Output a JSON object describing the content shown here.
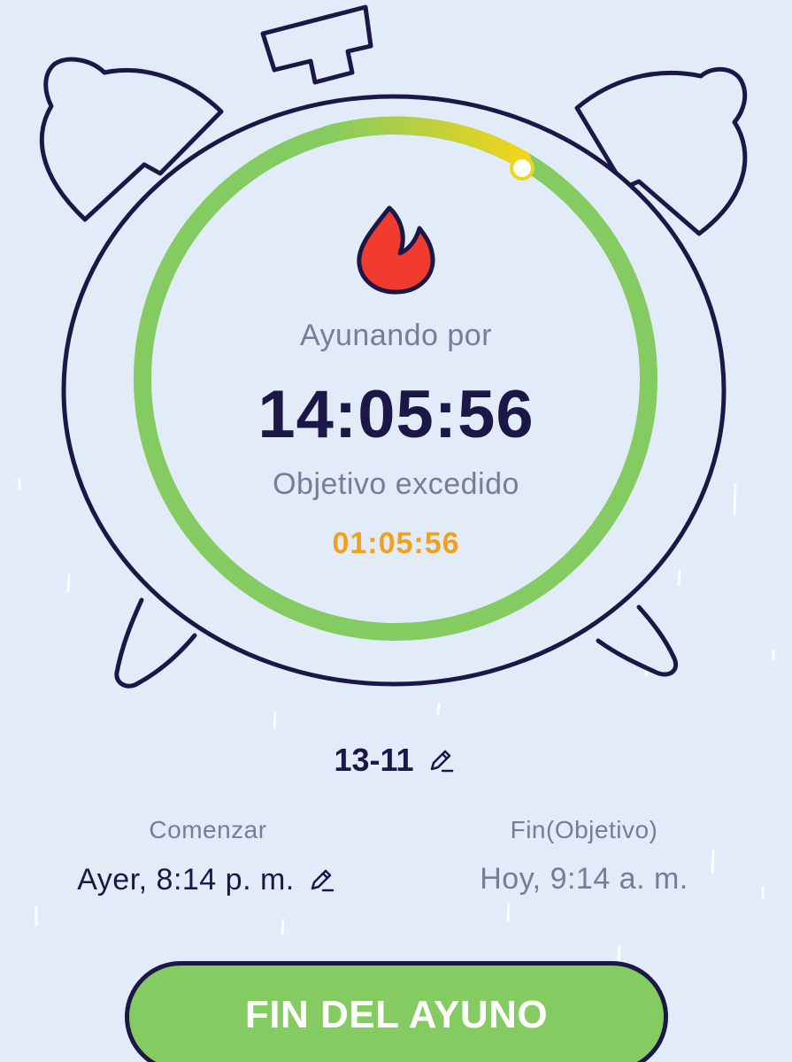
{
  "timer": {
    "status_label": "Ayunando por",
    "elapsed": "14:05:56",
    "goal_status": "Objetivo excedido",
    "exceeded_time": "01:05:56",
    "progress_fraction": 1.0,
    "progress_color_start": "#84cb61",
    "progress_color_end": "#f2d41a",
    "flame_color": "#f23b2f"
  },
  "plan": {
    "name": "13-11",
    "edit_icon": "pencil-icon"
  },
  "times": {
    "start_label": "Comenzar",
    "start_value": "Ayer, 8:14 p. m.",
    "end_label": "Fin(Objetivo)",
    "end_value": "Hoy, 9:14 a. m."
  },
  "actions": {
    "end_fast_label": "FIN DEL AYUNO"
  },
  "colors": {
    "background": "#e2ecf8",
    "outline": "#1b1847",
    "accent_green": "#84cb61",
    "accent_orange": "#f0a21e",
    "muted_text": "#7b7a98"
  }
}
